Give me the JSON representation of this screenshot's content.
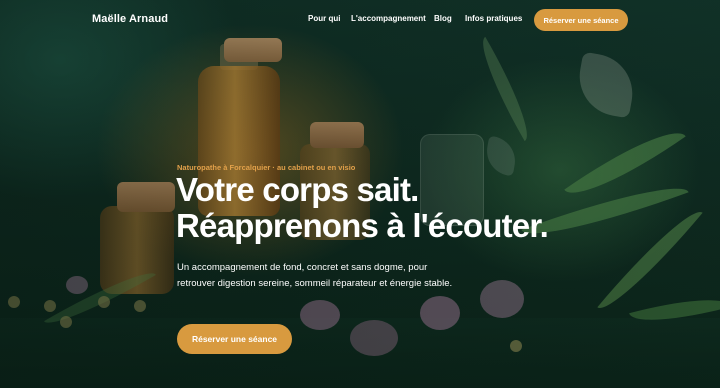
{
  "header": {
    "brand": "Maëlle Arnaud",
    "nav": [
      "Pour qui",
      "L'accompagnement",
      "Blog",
      "Infos pratiques"
    ],
    "cta_label": "Réserver une séance"
  },
  "hero": {
    "eyebrow": "Naturopathe à Forcalquier · au cabinet ou en visio",
    "headline_line1": "Votre corps sait.",
    "headline_line2": "Réapprenons à l'écouter.",
    "lede": "Un accompagnement de fond, concret et sans dogme, pour retrouver digestion sereine, sommeil réparateur et énergie stable.",
    "cta_label": "Réserver une séance"
  },
  "colors": {
    "accent": "#d89a3f",
    "eyebrow": "#e1a04a",
    "background": "#0f2a1f",
    "text": "#ffffff"
  }
}
